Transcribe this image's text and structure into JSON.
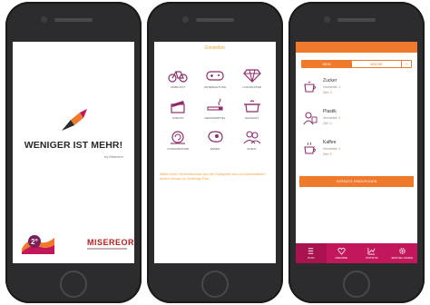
{
  "splash": {
    "title": "WENIGER IST MEHR!",
    "subtitle": "by Misereor",
    "partner_logo": "2°",
    "sponsor_name": "MISEREOR"
  },
  "categories_screen": {
    "heading": "Einstellen",
    "categories": [
      {
        "label": "MOBILITÄT",
        "icon": "bicycle-icon"
      },
      {
        "label": "UNTERHALTUNG",
        "icon": "gamepad-icon"
      },
      {
        "label": "LUXUSGÜTER",
        "icon": "diamond-icon"
      },
      {
        "label": "EVENTS",
        "icon": "clapperboard-icon"
      },
      {
        "label": "GENUSSMITTEL",
        "icon": "cigarette-icon"
      },
      {
        "label": "HAUSHALT",
        "icon": "cooking-pot-icon"
      },
      {
        "label": "KONSUMGÜTER",
        "icon": "snail-icon"
      },
      {
        "label": "ESSEN",
        "icon": "steak-icon"
      },
      {
        "label": "SOZIAL",
        "icon": "people-icon"
      }
    ],
    "description": "Wähle einen Verzichtsvorsatz aus den Kategorien aus und personalisiere deinen Vorsatz im Challenge Plan."
  },
  "tracker_screen": {
    "tabs": [
      {
        "label": "MEIN",
        "active": true
      },
      {
        "label": "WOCHE",
        "active": false
      },
      {
        "label": "+",
        "active": false
      }
    ],
    "items": [
      {
        "name": "Zucker",
        "icon": "cup-icon",
        "line1": "Verzichtet:",
        "value1": "2",
        "line2": "Ziel:",
        "value2": "3"
      },
      {
        "name": "Plastik",
        "icon": "bag-icon",
        "line1": "Verzichtet:",
        "value1": "2",
        "line2": "Ziel:",
        "value2": "3"
      },
      {
        "name": "Kaffee",
        "icon": "coffee-icon",
        "line1": "Verzichtet:",
        "value1": "2",
        "line2": "Ziel:",
        "value2": "3"
      }
    ],
    "cta_label": "VORSATZ HINZUFÜGEN",
    "nav": [
      {
        "label": "PLAN",
        "icon": "list-icon",
        "active": true
      },
      {
        "label": "FREUNDE",
        "icon": "heart-icon",
        "active": false
      },
      {
        "label": "STATISTIK",
        "icon": "chart-icon",
        "active": false
      },
      {
        "label": "EINSTELLUNGEN",
        "icon": "gear-icon",
        "active": false
      }
    ]
  },
  "colors": {
    "accent_orange": "#ef7a2d",
    "accent_magenta": "#c2175b",
    "icon_purple": "#8e2d6a",
    "label_gold": "#f0a23a",
    "phone_body": "#2c2c2e"
  }
}
